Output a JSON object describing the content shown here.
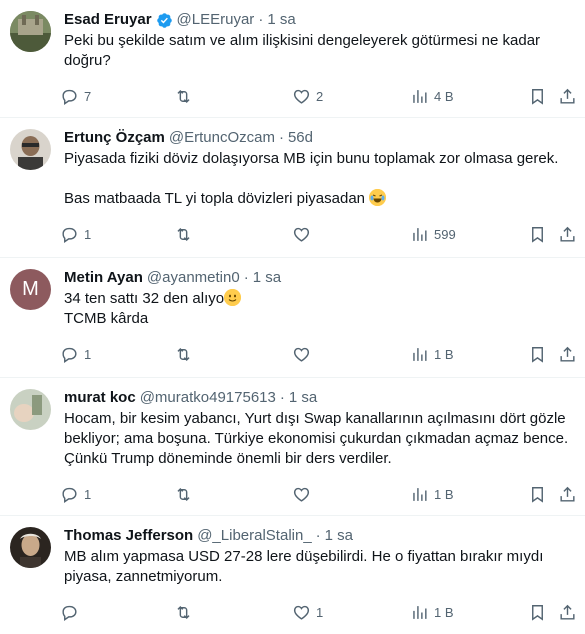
{
  "tweets": [
    {
      "name": "Esad Eruyar",
      "verified": true,
      "handle": "@LEEruyar",
      "time": "1 sa",
      "lines": [
        "Peki bu şekilde satım ve alım ilişkisini dengeleyerek götürmesi ne kadar doğru?"
      ],
      "replies": "7",
      "retweets": "",
      "likes": "2",
      "views": "4 B",
      "avatar_color": "#5a6b4a"
    },
    {
      "name": "Ertunç Özçam",
      "verified": false,
      "handle": "@ErtuncOzcam",
      "time": "56d",
      "line1": "Piyasada fiziki döviz dolaşıyorsa MB için bunu toplamak zor olmasa gerek.",
      "line2": "Bas matbaada TL yi topla dövizleri piyasadan",
      "emoji": "face-with-tears-of-joy",
      "replies": "1",
      "retweets": "",
      "likes": "",
      "views": "599",
      "avatar_color": "#6b6152"
    },
    {
      "name": "Metin Ayan",
      "verified": false,
      "handle": "@ayanmetin0",
      "time": "1 sa",
      "line1": "34 ten sattı 32 den alıyo",
      "emoji": "slightly-smiling-face",
      "line2": "TCMB kârda",
      "avatar_letter": "M",
      "avatar_color": "#8d5a5e",
      "replies": "1",
      "retweets": "",
      "likes": "",
      "views": "1 B"
    },
    {
      "name": "murat koc",
      "verified": false,
      "handle": "@muratko49175613",
      "time": "1 sa",
      "lines": [
        "Hocam, bir kesim yabancı, Yurt dışı Swap kanallarının açılmasını dört gözle bekliyor; ama boşuna. Türkiye ekonomisi çukurdan çıkmadan açmaz bence. Çünkü Trump döneminde önemli bir ders verdiler."
      ],
      "replies": "1",
      "retweets": "",
      "likes": "",
      "views": "1 B",
      "avatar_color": "#b9c4b0"
    },
    {
      "name": "Thomas Jefferson",
      "verified": false,
      "handle": "@_LiberalStalin_",
      "time": "1 sa",
      "lines": [
        "MB alım yapmasa USD 27-28 lere düşebilirdi. He o fiyattan bırakır mıydı piyasa, zannetmiyorum."
      ],
      "replies": "",
      "retweets": "",
      "likes": "1",
      "views": "1 B",
      "avatar_color": "#2b2520"
    }
  ],
  "separator": "·",
  "colors": {
    "text": "#0f1419",
    "secondary": "#536471",
    "verified": "#1d9bf0",
    "border": "#eff3f4"
  }
}
